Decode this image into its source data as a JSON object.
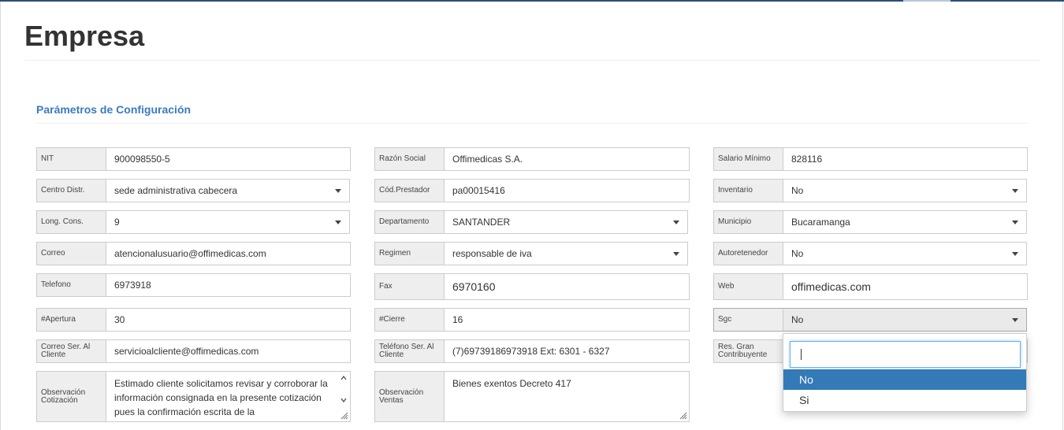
{
  "page": {
    "title": "Empresa"
  },
  "section": {
    "title": "Parámetros de Configuración"
  },
  "fields": {
    "nit": {
      "label": "NIT",
      "value": "900098550-5"
    },
    "razon_social": {
      "label": "Razón Social",
      "value": "Offimedicas S.A."
    },
    "salario_minimo": {
      "label": "Salario Mínimo",
      "value": "828116"
    },
    "centro_distr": {
      "label": "Centro Distr.",
      "value": "sede administrativa cabecera"
    },
    "cod_prestador": {
      "label": "Cód.Prestador",
      "value": "pa00015416"
    },
    "inventario": {
      "label": "Inventario",
      "value": "No"
    },
    "long_cons": {
      "label": "Long. Cons.",
      "value": "9"
    },
    "departamento": {
      "label": "Departamento",
      "value": "SANTANDER"
    },
    "municipio": {
      "label": "Municipio",
      "value": "Bucaramanga"
    },
    "correo": {
      "label": "Correo",
      "value": "atencionalusuario@offimedicas.com"
    },
    "regimen": {
      "label": "Regimen",
      "value": "responsable de iva"
    },
    "autoretenedor": {
      "label": "Autoretenedor",
      "value": "No"
    },
    "telefono": {
      "label": "Telefono",
      "value": "6973918"
    },
    "fax": {
      "label": "Fax",
      "value": "6970160"
    },
    "web": {
      "label": "Web",
      "value": "offimedicas.com"
    },
    "apertura": {
      "label": "#Apertura",
      "value": "30"
    },
    "cierre": {
      "label": "#Cierre",
      "value": "16"
    },
    "sgc": {
      "label": "Sgc",
      "value": "No"
    },
    "correo_ser": {
      "label": "Correo Ser. Al Cliente",
      "value": "servicioalcliente@offimedicas.com"
    },
    "telefono_ser": {
      "label": "Teléfono Ser. Al Cliente",
      "value": "(7)69739186973918 Ext:  6301 - 6327"
    },
    "res_gran": {
      "label": "Res. Gran Contribuyente",
      "value": ""
    },
    "obs_cotizacion": {
      "label": "Observación Cotización",
      "value": "Estimado cliente solicitamos revisar y corroborar la información consignada en la presente cotización pues la confirmación escrita de la"
    },
    "obs_ventas": {
      "label": "Observación Ventas",
      "value": "Bienes exentos Decreto 417"
    }
  },
  "sgc_dropdown": {
    "search_value": "",
    "options": [
      "No",
      "Si"
    ],
    "highlighted": "No"
  }
}
